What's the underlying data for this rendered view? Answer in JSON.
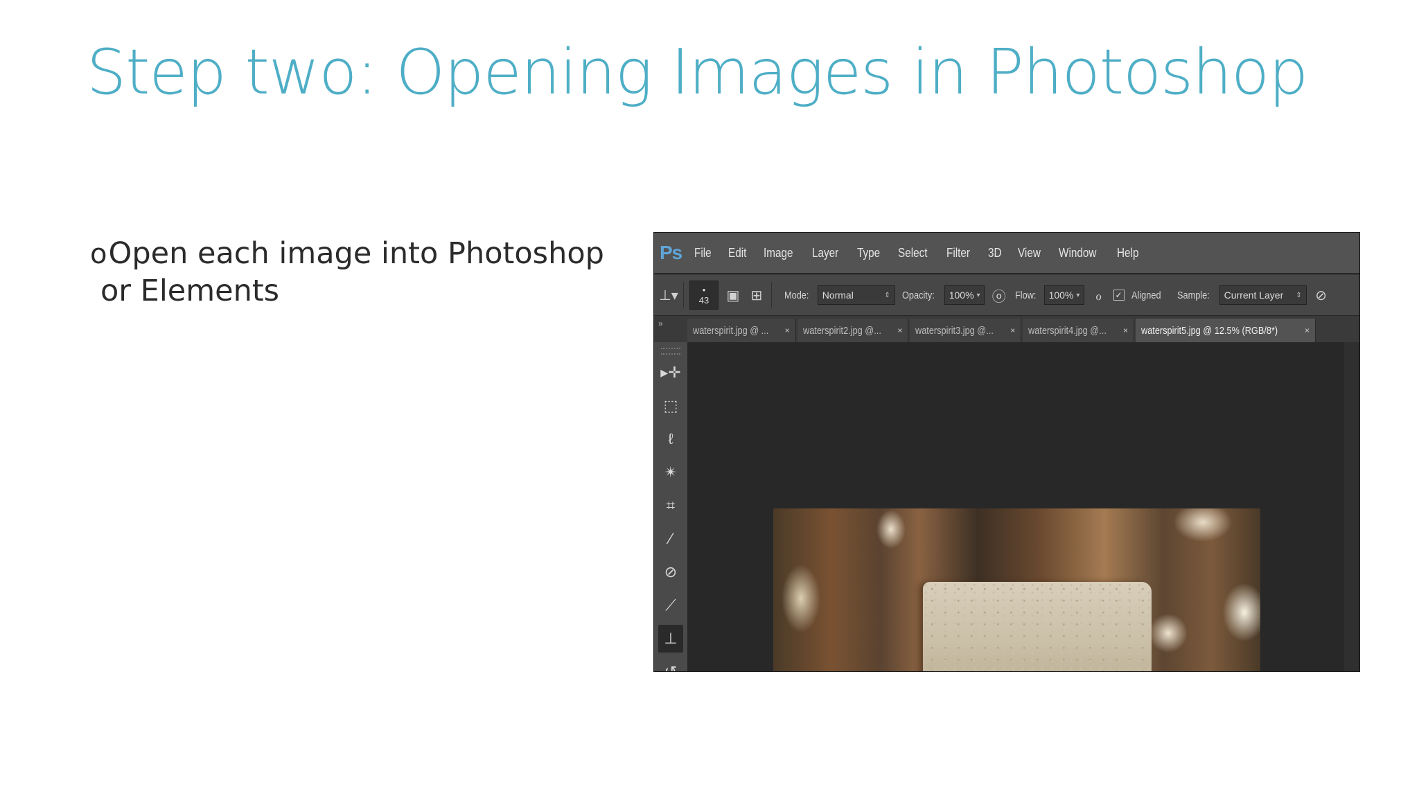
{
  "slide": {
    "title": "Step two: Opening Images in Photoshop",
    "bullet_marker": "o",
    "bullet_line1": "Open each image into Photoshop",
    "bullet_line2": "or Elements"
  },
  "photoshop": {
    "logo": "Ps",
    "menu": [
      "File",
      "Edit",
      "Image",
      "Layer",
      "Type",
      "Select",
      "Filter",
      "3D",
      "View",
      "Window",
      "Help"
    ],
    "options": {
      "brush_size": "43",
      "mode_label": "Mode:",
      "mode_value": "Normal",
      "opacity_label": "Opacity:",
      "opacity_value": "100%",
      "flow_label": "Flow:",
      "flow_value": "100%",
      "aligned_label": "Aligned",
      "sample_label": "Sample:",
      "sample_value": "Current Layer"
    },
    "tabs": [
      {
        "label": "waterspirit.jpg @ ...",
        "close": "×"
      },
      {
        "label": "waterspirit2.jpg @...",
        "close": "×"
      },
      {
        "label": "waterspirit3.jpg @...",
        "close": "×"
      },
      {
        "label": "waterspirit4.jpg @...",
        "close": "×"
      },
      {
        "label": "waterspirit5.jpg @ 12.5% (RGB/8*)",
        "close": "×"
      }
    ],
    "active_tab_index": 4,
    "tools": [
      "move-icon",
      "marquee-icon",
      "lasso-icon",
      "magic-wand-icon",
      "crop-icon",
      "eyedropper-icon",
      "healing-brush-icon",
      "brush-icon",
      "clone-stamp-icon",
      "history-brush-icon"
    ],
    "colors": {
      "title": "#4eaec6",
      "ps_logo": "#5fa5d6",
      "menubar": "#535353",
      "canvas": "#282828"
    }
  }
}
